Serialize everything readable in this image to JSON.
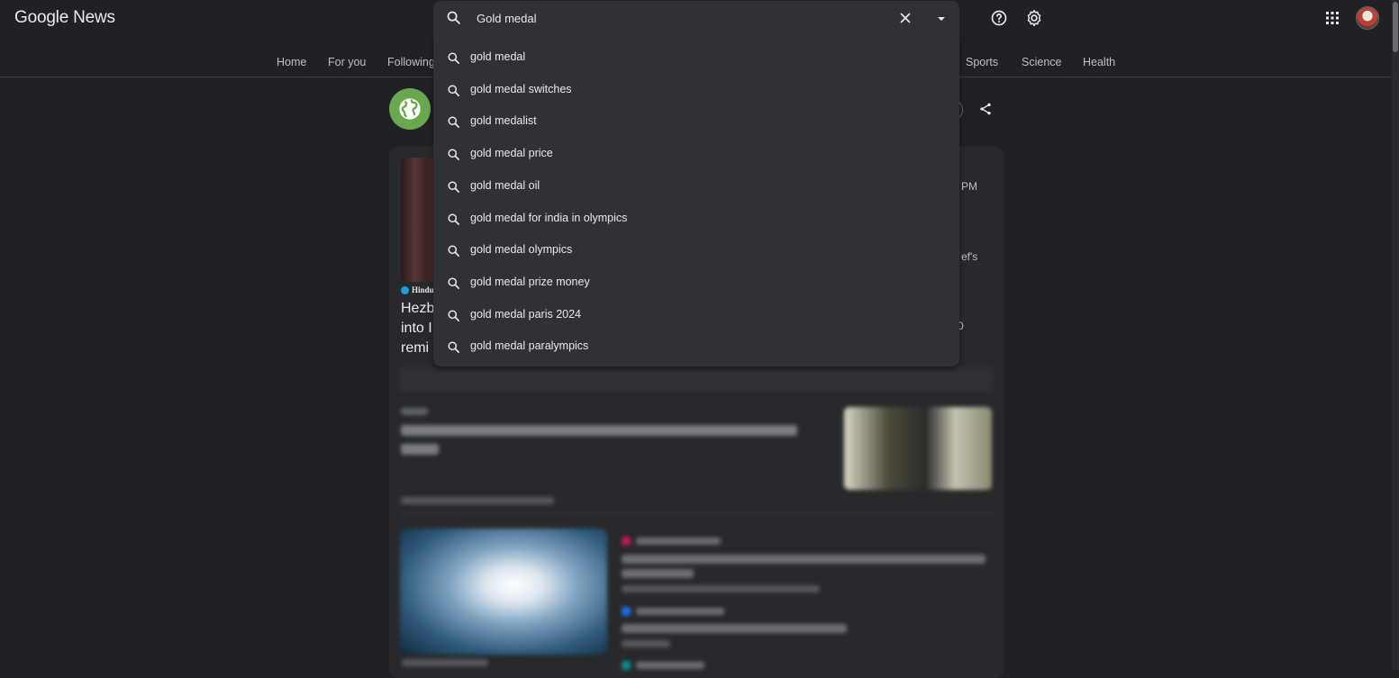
{
  "header": {
    "logo_text": "Google News",
    "help_icon": "help-icon",
    "settings_icon": "gear-icon",
    "apps_icon": "apps-grid-icon"
  },
  "nav": {
    "items": [
      {
        "label": "Home"
      },
      {
        "label": "For you"
      },
      {
        "label": "Following"
      },
      {
        "label": "Sports"
      },
      {
        "label": "Science"
      },
      {
        "label": "Health"
      }
    ]
  },
  "search": {
    "value": "Gold medal",
    "suggestions": [
      "gold medal",
      "gold medal switches",
      "gold medalist",
      "gold medal price",
      "gold medal oil",
      "gold medal for india in olympics",
      "gold medal olympics",
      "gold medal prize money",
      "gold medal paris 2024",
      "gold medal paralympics"
    ]
  },
  "content": {
    "source_logo": "Hindu",
    "headline_fragments": [
      "Hezb",
      "into I",
      "remi"
    ],
    "side_fragments": [
      "PM",
      "ef's",
      "0"
    ]
  },
  "colors": {
    "background": "#202124",
    "surface": "#303134",
    "topic_green": "#6aa84f"
  }
}
